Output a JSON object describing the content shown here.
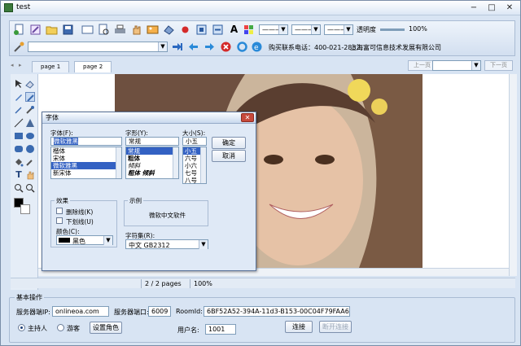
{
  "window": {
    "title": "test",
    "min": "−",
    "max": "□",
    "close": "✕"
  },
  "toolbar": {
    "opacity_label": "透明度",
    "opacity_value": "100%",
    "contact": "购买联系电话：400-021-2832",
    "company": "上海富可信息技术发展有限公司",
    "url_value": "",
    "line1": "———",
    "line2": "———",
    "line3": "———"
  },
  "tabs": {
    "items": [
      {
        "label": "page 1"
      },
      {
        "label": "page 2"
      }
    ],
    "prev": "上一页",
    "next": "下一页",
    "page_select": ""
  },
  "status": {
    "pages": "2 / 2 pages",
    "zoom": "100%"
  },
  "basic": {
    "legend": "基本操作",
    "server_addr_label": "服务器端IP:",
    "server_addr_value": "onlineoa.com",
    "server_port_label": "服务器端口:",
    "server_port_value": "6009",
    "roomid_label": "RoomId:",
    "roomid_value": "6BF52A52-394A-11d3-B153-00C04F79FAA6",
    "host_label": "主持人",
    "guest_label": "游客",
    "set_role": "设置角色",
    "username_label": "用户名:",
    "username_value": "1001",
    "connect": "连接",
    "disconnect": "断开连接"
  },
  "font_dialog": {
    "title": "字体",
    "close": "✕",
    "font_label": "字体(F):",
    "font_value": "微软雅黑",
    "fonts": [
      "楷体",
      "宋体",
      "微软雅黑",
      "新宋体"
    ],
    "style_label": "字形(Y):",
    "style_value": "常规",
    "styles": [
      "常规",
      "粗体",
      "倾斜",
      "粗体 倾斜"
    ],
    "size_label": "大小(S):",
    "size_value": "小五",
    "sizes": [
      "小五",
      "六号",
      "小六",
      "七号",
      "八号"
    ],
    "ok": "确定",
    "cancel": "取消",
    "effects_label": "效果",
    "strike_label": "删除线(K)",
    "underline_label": "下划线(U)",
    "color_label": "颜色(C):",
    "color_value": "黑色",
    "sample_label": "示例",
    "sample_text": "微软中文软件",
    "charset_label": "字符集(R):",
    "charset_value": "中文 GB2312"
  },
  "colors": {
    "accent": "#3361c3",
    "title_bg": "#dce7f5",
    "window_bg": "#d8e4f3"
  }
}
